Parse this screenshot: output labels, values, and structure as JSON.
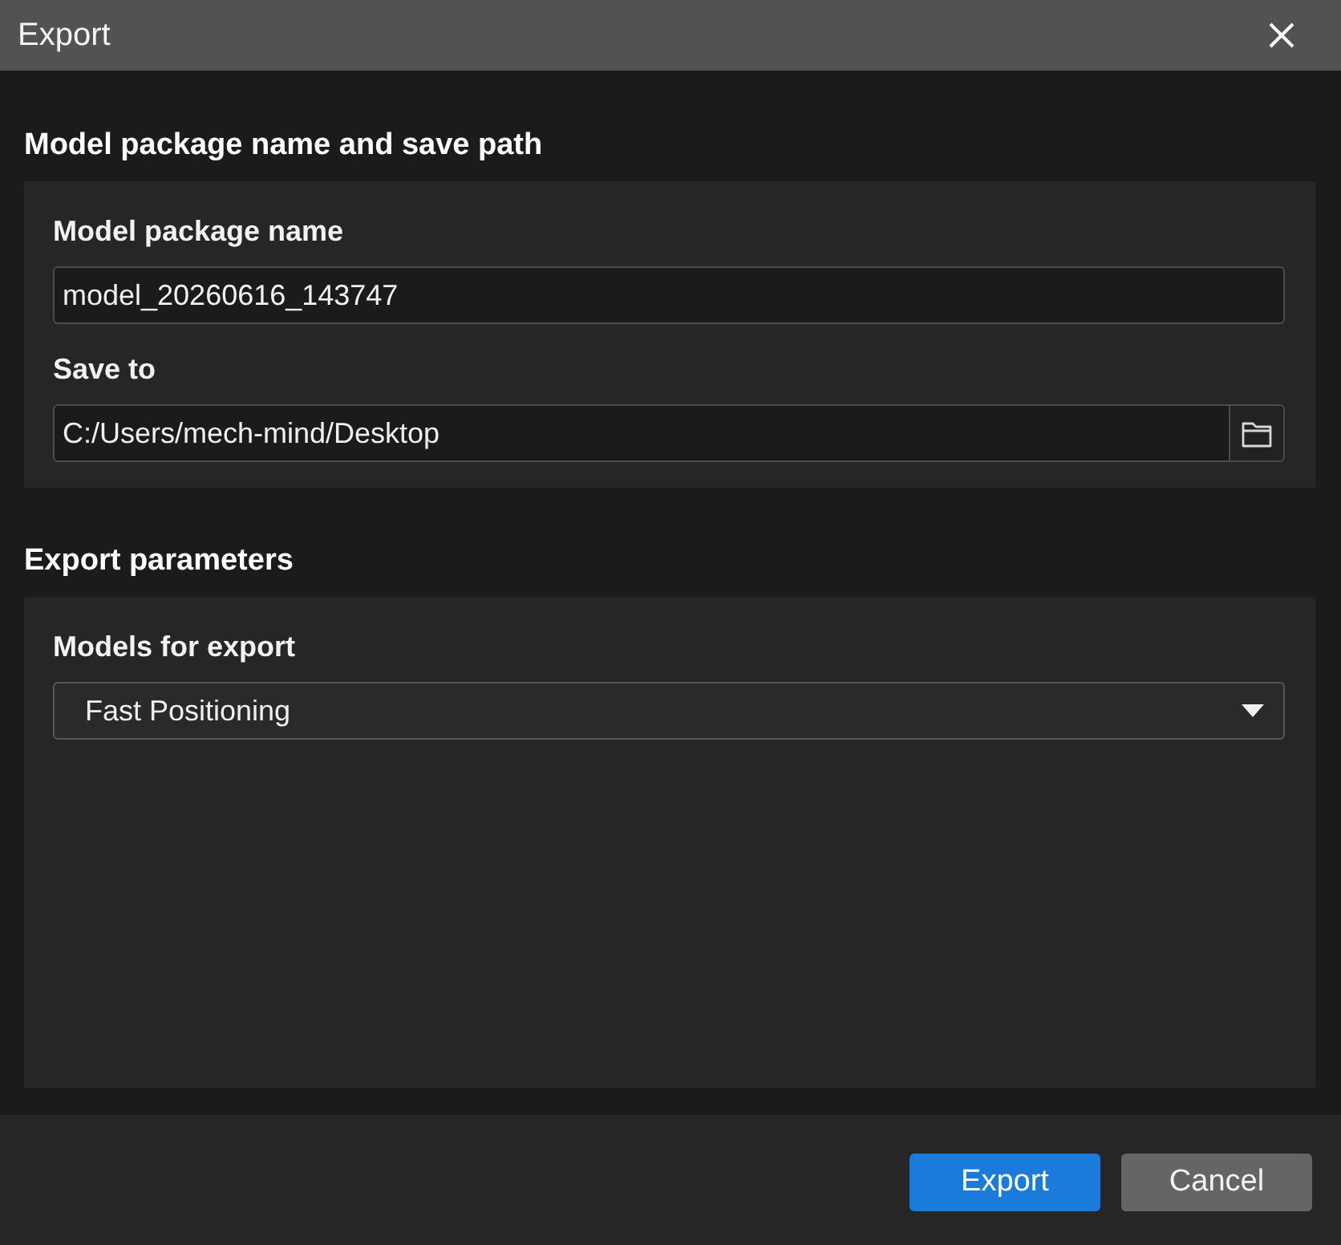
{
  "window": {
    "title": "Export"
  },
  "sections": [
    {
      "heading": "Model package name and save path",
      "fields": [
        {
          "kind": "text",
          "label": "Model package name",
          "value": "model_20260616_143747"
        },
        {
          "kind": "path",
          "label": "Save to",
          "value": "C:/Users/mech-mind/Desktop"
        }
      ]
    },
    {
      "heading": "Export parameters",
      "fields": [
        {
          "kind": "dropdown",
          "label": "Models for export",
          "value": "Fast Positioning"
        }
      ]
    }
  ],
  "buttons": [
    {
      "label": "Export",
      "kind": "primary"
    },
    {
      "label": "Cancel",
      "kind": "secondary"
    }
  ]
}
